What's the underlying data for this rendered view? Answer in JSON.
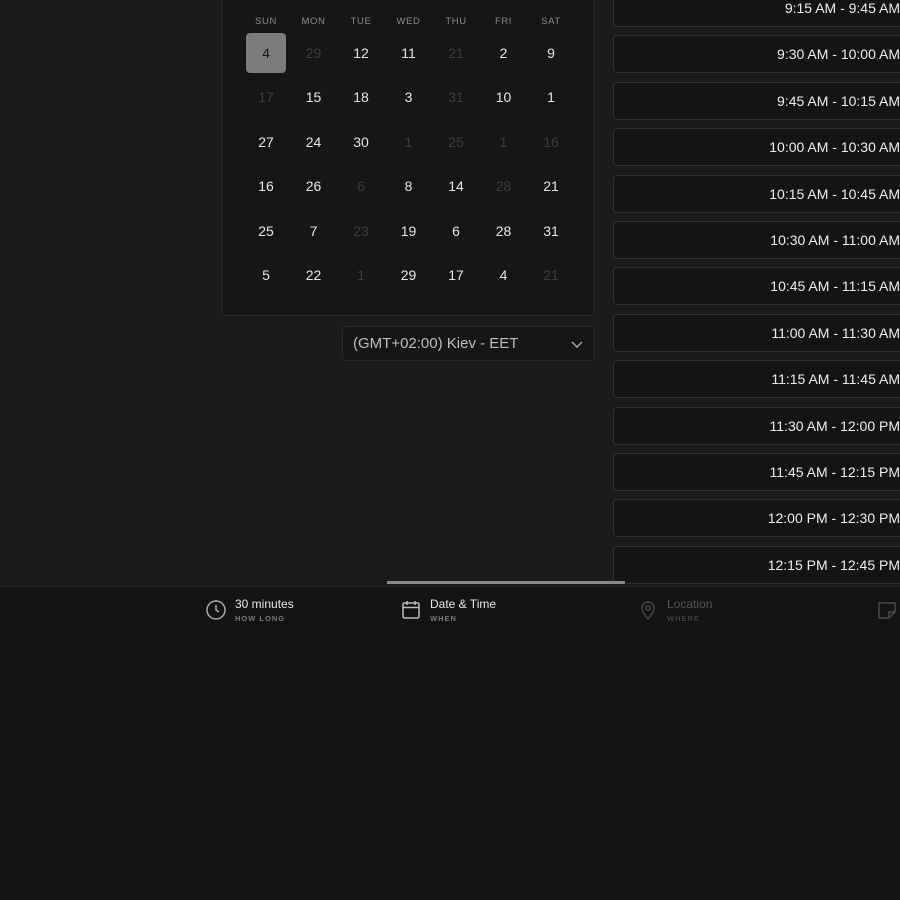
{
  "calendar": {
    "weekdays": [
      "SUN",
      "MON",
      "TUE",
      "WED",
      "THU",
      "FRI",
      "SAT"
    ],
    "weeks": [
      [
        {
          "d": "4",
          "m": false,
          "sel": true
        },
        {
          "d": "29",
          "m": true
        },
        {
          "d": "12",
          "m": false
        },
        {
          "d": "11",
          "m": false
        },
        {
          "d": "21",
          "m": true
        },
        {
          "d": "2",
          "m": false
        },
        {
          "d": "9",
          "m": false
        }
      ],
      [
        {
          "d": "17",
          "m": true
        },
        {
          "d": "15",
          "m": false
        },
        {
          "d": "18",
          "m": false
        },
        {
          "d": "3",
          "m": false
        },
        {
          "d": "31",
          "m": true
        },
        {
          "d": "10",
          "m": false
        },
        {
          "d": "1",
          "m": false
        }
      ],
      [
        {
          "d": "27",
          "m": false
        },
        {
          "d": "24",
          "m": false
        },
        {
          "d": "30",
          "m": false
        },
        {
          "d": "1",
          "m": true
        },
        {
          "d": "25",
          "m": true
        },
        {
          "d": "1",
          "m": true
        },
        {
          "d": "16",
          "m": true
        }
      ],
      [
        {
          "d": "16",
          "m": false
        },
        {
          "d": "26",
          "m": false
        },
        {
          "d": "6",
          "m": true
        },
        {
          "d": "8",
          "m": false
        },
        {
          "d": "14",
          "m": false
        },
        {
          "d": "28",
          "m": true
        },
        {
          "d": "21",
          "m": false
        }
      ],
      [
        {
          "d": "25",
          "m": false
        },
        {
          "d": "7",
          "m": false
        },
        {
          "d": "23",
          "m": true
        },
        {
          "d": "19",
          "m": false
        },
        {
          "d": "6",
          "m": false
        },
        {
          "d": "28",
          "m": false
        },
        {
          "d": "31",
          "m": false
        }
      ],
      [
        {
          "d": "5",
          "m": false
        },
        {
          "d": "22",
          "m": false
        },
        {
          "d": "1",
          "m": true
        },
        {
          "d": "29",
          "m": false
        },
        {
          "d": "17",
          "m": false
        },
        {
          "d": "4",
          "m": false
        },
        {
          "d": "21",
          "m": true
        }
      ]
    ]
  },
  "timezone": {
    "value": "(GMT+02:00) Kiev - EET",
    "icon": "chevron-down-icon"
  },
  "time_slots": [
    "9:15 AM - 9:45 AM",
    "9:30 AM - 10:00 AM",
    "9:45 AM - 10:15 AM",
    "10:00 AM - 10:30 AM",
    "10:15 AM - 10:45 AM",
    "10:30 AM - 11:00 AM",
    "10:45 AM - 11:15 AM",
    "11:00 AM - 11:30 AM",
    "11:15 AM - 11:45 AM",
    "11:30 AM - 12:00 PM",
    "11:45 AM - 12:15 PM",
    "12:00 PM - 12:30 PM",
    "12:15 PM - 12:45 PM"
  ],
  "nav": {
    "duration": {
      "title": "30 minutes",
      "sub": "HOW LONG",
      "icon": "clock-icon"
    },
    "datetime": {
      "title": "Date & Time",
      "sub": "WHEN",
      "icon": "calendar-icon"
    },
    "location": {
      "title": "Location",
      "sub": "WHERE",
      "icon": "map-pin-icon"
    },
    "notes": {
      "icon": "note-icon"
    }
  },
  "colors": {
    "background": "#1b1b1b",
    "panel": "#161616",
    "selected_day": "#7b7b7b",
    "active_indicator": "#8a8a8a"
  }
}
